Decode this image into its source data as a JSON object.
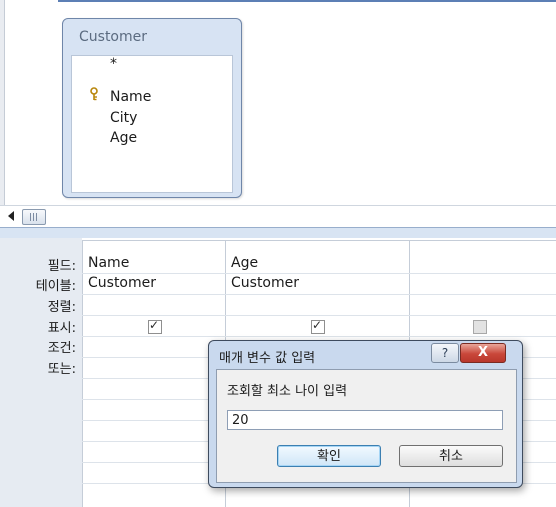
{
  "table": {
    "title": "Customer",
    "fields": [
      "*",
      "Name",
      "City",
      "Age"
    ]
  },
  "grid": {
    "row_labels": [
      "필드:",
      "테이블:",
      "정렬:",
      "표시:",
      "조건:",
      "또는:"
    ],
    "columns": [
      {
        "field": "Name",
        "table": "Customer",
        "show": true
      },
      {
        "field": "Age",
        "table": "Customer",
        "show": true
      },
      {
        "field": "",
        "table": "",
        "show": false
      }
    ]
  },
  "dialog": {
    "title": "매개 변수 값 입력",
    "help_label": "?",
    "close_label": "X",
    "prompt": "조회할 최소 나이 입력",
    "input_value": "20",
    "ok_label": "확인",
    "cancel_label": "취소"
  }
}
